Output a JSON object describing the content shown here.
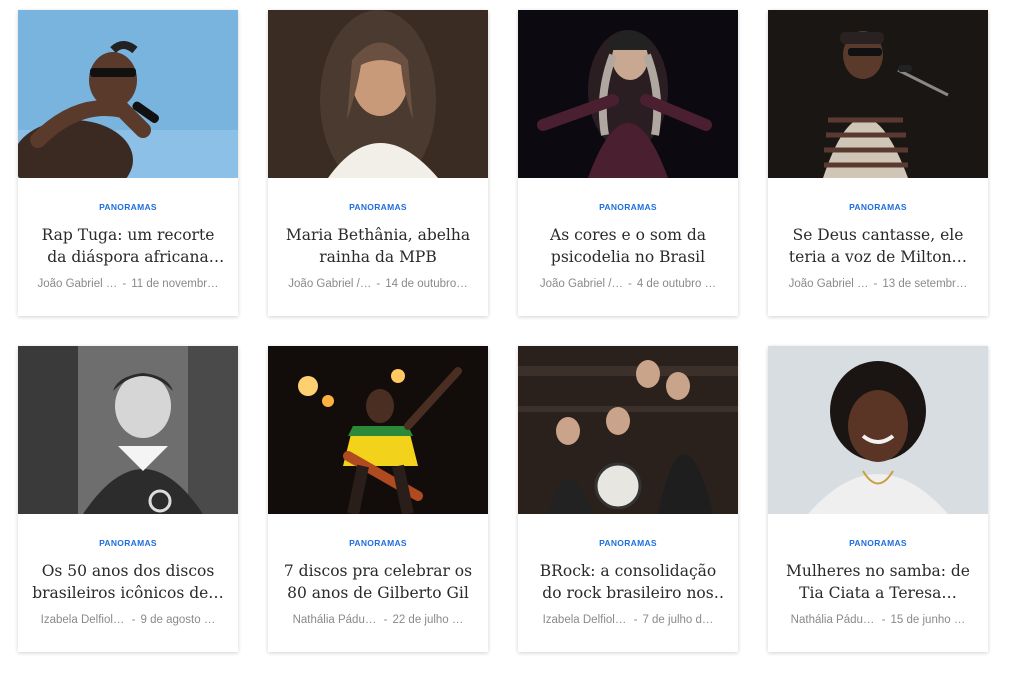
{
  "cards": [
    {
      "category": "PANORAMAS",
      "title": "Rap Tuga: um recorte da diáspora africana em…",
      "author": "João Gabriel …",
      "date": "11 de novembr…",
      "image": "rapper-with-microphone-photo"
    },
    {
      "category": "PANORAMAS",
      "title": "Maria Bethânia, abelha rainha da MPB",
      "author": "João Gabriel /…",
      "date": "14 de outubro…",
      "image": "woman-portrait-photo"
    },
    {
      "category": "PANORAMAS",
      "title": "As cores e o som da psicodelia no Brasil",
      "author": "João Gabriel /…",
      "date": "4 de outubro …",
      "image": "performer-on-stage-photo"
    },
    {
      "category": "PANORAMAS",
      "title": "Se Deus cantasse, ele teria a voz de Milton…",
      "author": "João Gabriel …",
      "date": "13 de setembr…",
      "image": "singer-at-microphone-photo"
    },
    {
      "category": "PANORAMAS",
      "title": "Os 50 anos dos discos brasileiros icônicos de…",
      "author": "Izabela Delfiol /…",
      "date": "9 de agosto …",
      "image": "black-and-white-singer-photo"
    },
    {
      "category": "PANORAMAS",
      "title": "7 discos pra celebrar os 80 anos de Gilberto Gil",
      "author": "Nathália Pádua …",
      "date": "22 de julho …",
      "image": "guitarist-on-stage-photo"
    },
    {
      "category": "PANORAMAS",
      "title": "BRock: a consolidação do rock brasileiro nos anos…",
      "author": "Izabela Delfiol /…",
      "date": "7 de julho d…",
      "image": "rock-band-photo"
    },
    {
      "category": "PANORAMAS",
      "title": "Mulheres no samba: de Tia Ciata a Teresa…",
      "author": "Nathália Pádua …",
      "date": "15 de junho …",
      "image": "woman-smiling-portrait-photo"
    }
  ],
  "meta_separator": "-"
}
